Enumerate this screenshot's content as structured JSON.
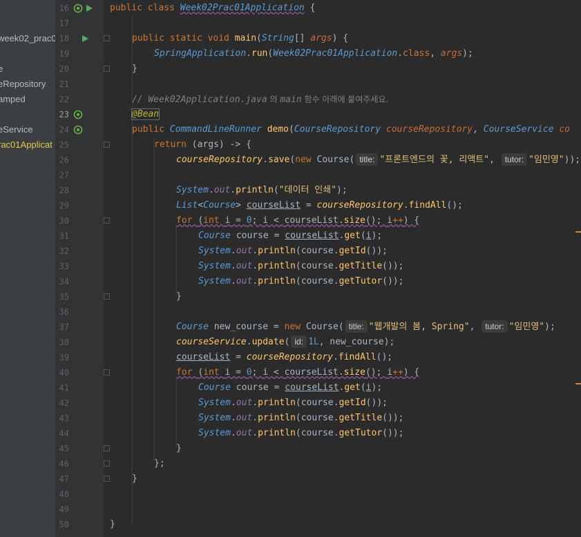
{
  "sidebar": {
    "items": [
      {
        "label": "week02_prac0",
        "active": false
      },
      {
        "label": "e",
        "active": false
      },
      {
        "label": "eRepository",
        "active": false
      },
      {
        "label": "amped",
        "active": false
      },
      {
        "label": "eService",
        "active": false
      },
      {
        "label": "rac01Applicat",
        "active": true
      }
    ]
  },
  "editor": {
    "line_numbers": [
      "16",
      "17",
      "18",
      "19",
      "20",
      "21",
      "22",
      "23",
      "24",
      "25",
      "26",
      "27",
      "28",
      "29",
      "30",
      "31",
      "32",
      "33",
      "34",
      "35",
      "36",
      "37",
      "38",
      "39",
      "40",
      "41",
      "42",
      "43",
      "44",
      "45",
      "46",
      "47",
      "48",
      "49",
      "50"
    ],
    "current_line": "23",
    "code": {
      "l16": {
        "kw": "public class ",
        "name": "Week02Prac01Application",
        "rest": " {"
      },
      "l18": {
        "kw": "public static void ",
        "fn": "main",
        "p1": "(",
        "type": "String",
        "p2": "[] ",
        "param": "args",
        "p3": ") {"
      },
      "l19": {
        "cls": "SpringApplication",
        "dot": ".",
        "fn": "run",
        "p1": "(",
        "cls2": "Week02Prac01Application",
        "dot2": ".",
        "kw": "class",
        "p2": ", ",
        "param": "args",
        "p3": ");"
      },
      "l20": {
        "text": "}"
      },
      "l22": {
        "comment_prefix": "// ",
        "comment_file": "Week02Application.java",
        "comment_ko1": " 의 ",
        "comment_main": "main",
        "comment_ko2": " 함수 아래에 붙여주세요."
      },
      "l23": {
        "ann": "@Bean"
      },
      "l24": {
        "kw": "public ",
        "type": "CommandLineRunner",
        "sp": " ",
        "fn": "demo",
        "p1": "(",
        "type2": "CourseRepository",
        "sp2": " ",
        "param": "courseRepository",
        "p2": ", ",
        "type3": "CourseService",
        "sp3": " ",
        "param2": "co"
      },
      "l25": {
        "kw": "return ",
        "rest": "(args) -> {"
      },
      "l26": {
        "ivar": "courseRepository",
        "dot": ".",
        "fn": "save",
        "p1": "(",
        "kw": "new ",
        "cls": "Course",
        "p2": "(",
        "hint1": "title:",
        "str1": "\"프론트엔드의 꽃, 리액트\"",
        "p3": ", ",
        "hint2": "tutor:",
        "str2": "\"임민영\"",
        "p4": "));"
      },
      "l28": {
        "cls": "System",
        "dot": ".",
        "fld": "out",
        "dot2": ".",
        "fn": "println",
        "p1": "(",
        "str": "\"데이터 인쇄\"",
        "p2": ");"
      },
      "l29": {
        "type": "List",
        "p1": "<",
        "type2": "Course",
        "p2": "> ",
        "var": "courseList",
        "p3": " = ",
        "ivar": "courseRepository",
        "dot": ".",
        "fn": "findAll",
        "p4": "();"
      },
      "l30": {
        "kw": "for ",
        "p1": "(",
        "kw2": "int ",
        "v": "i",
        "p2": " = ",
        "num": "0",
        "p3": "; ",
        "v2": "i",
        "p4": " < ",
        "var": "courseList",
        "dot": ".",
        "fn": "size",
        "p5": "(); ",
        "v3": "i",
        "op": "++",
        "p6": ") {"
      },
      "l31": {
        "type": "Course",
        "p1": " course = ",
        "var": "courseList",
        "dot": ".",
        "fn": "get",
        "p2": "(",
        "v": "i",
        "p3": ");"
      },
      "l32": {
        "cls": "System",
        "dot": ".",
        "fld": "out",
        "dot2": ".",
        "fn": "println",
        "p1": "(course.",
        "fn2": "getId",
        "p2": "());"
      },
      "l33": {
        "cls": "System",
        "dot": ".",
        "fld": "out",
        "dot2": ".",
        "fn": "println",
        "p1": "(course.",
        "fn2": "getTitle",
        "p2": "());"
      },
      "l34": {
        "cls": "System",
        "dot": ".",
        "fld": "out",
        "dot2": ".",
        "fn": "println",
        "p1": "(course.",
        "fn2": "getTutor",
        "p2": "());"
      },
      "l35": {
        "text": "}"
      },
      "l37": {
        "type": "Course",
        "p1": " new_course = ",
        "kw": "new ",
        "cls": "Course",
        "p2": "(",
        "hint1": "title:",
        "str1": "\"웹개발의 봄, Spring\"",
        "p3": ", ",
        "hint2": "tutor:",
        "str2": "\"임민영\"",
        "p4": ");"
      },
      "l38": {
        "ivar": "courseService",
        "dot": ".",
        "fn": "update",
        "p1": "(",
        "hint": "id:",
        "num": "1L",
        "p2": ", new_course);"
      },
      "l39": {
        "var": "courseList",
        "p1": " = ",
        "ivar": "courseRepository",
        "dot": ".",
        "fn": "findAll",
        "p2": "();"
      },
      "l45": {
        "text": "}"
      },
      "l46": {
        "text": "};"
      },
      "l47": {
        "text": "}"
      },
      "l50": {
        "text": "}"
      }
    }
  }
}
